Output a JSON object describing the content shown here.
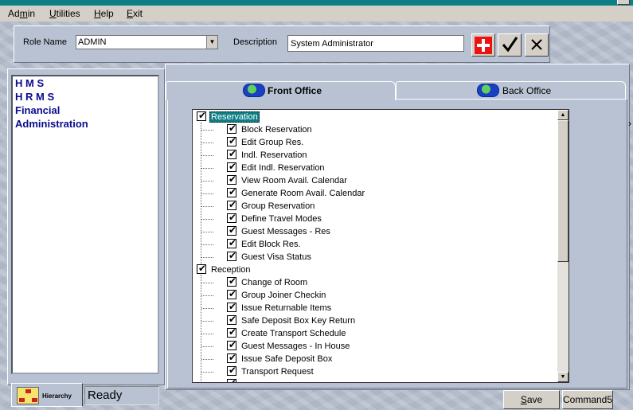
{
  "menu": {
    "admin": {
      "pre": "Ad",
      "u": "m",
      "post": "in"
    },
    "utilities": {
      "pre": "",
      "u": "U",
      "post": "tilities"
    },
    "help": {
      "pre": "",
      "u": "H",
      "post": "elp"
    },
    "exit": {
      "pre": "",
      "u": "E",
      "post": "xit"
    }
  },
  "role": {
    "name_label": "Role Name",
    "name_value": "ADMIN",
    "desc_label": "Description",
    "desc_value": "System Administrator"
  },
  "modules": [
    "H M S",
    "H R M S",
    "Financial",
    "Administration"
  ],
  "bottom_left": {
    "hierarchy_label": "Hierarchy",
    "status": "Ready"
  },
  "tabs": {
    "front_office": "Front Office",
    "back_office": "Back Office"
  },
  "tree": {
    "groups": [
      {
        "label": "Reservation",
        "items": [
          "Block Reservation",
          "Edit Group Res.",
          "Indl. Reservation",
          "Edit Indl. Reservation",
          "View Room Avail. Calendar",
          "Generate Room Avail. Calendar",
          "Group Reservation",
          "Define Travel Modes",
          "Guest Messages - Res",
          "Edit Block Res.",
          "Guest Visa Status"
        ]
      },
      {
        "label": "Reception",
        "items": [
          "Change of Room",
          "Group Joiner Checkin",
          "Issue Returnable Items",
          "Safe Deposit Box Key Return",
          "Create Transport Schedule",
          "Guest Messages - In House",
          "Issue Safe Deposit Box",
          "Transport Request"
        ]
      }
    ]
  },
  "buttons": {
    "save_pre": "",
    "save_u": "S",
    "save_post": "ave",
    "command5": "Command5"
  },
  "colors": {
    "titlebar": "#0f7f86",
    "module_text": "#0a0a8c",
    "add_button": "#e11111"
  }
}
